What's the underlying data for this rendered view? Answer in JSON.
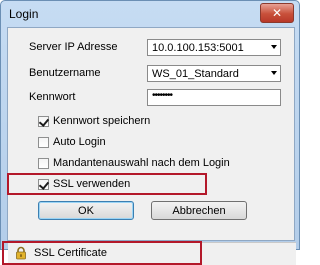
{
  "window": {
    "title": "Login",
    "close_glyph": "✕"
  },
  "form": {
    "server_label": "Server IP Adresse",
    "server_value": "10.0.100.153:5001",
    "user_label": "Benutzername",
    "user_value": "WS_01_Standard",
    "password_label": "Kennwort",
    "password_value": "••••••••"
  },
  "options": {
    "save_password": {
      "label": "Kennwort speichern",
      "checked": true
    },
    "auto_login": {
      "label": "Auto Login",
      "checked": false
    },
    "client_selection": {
      "label": "Mandantenauswahl nach dem Login",
      "checked": false
    },
    "use_ssl": {
      "label": "SSL verwenden",
      "checked": true
    }
  },
  "buttons": {
    "ok": "OK",
    "cancel": "Abbrechen"
  },
  "status": {
    "icon": "lock-icon",
    "text": "SSL Certificate"
  },
  "colors": {
    "highlight": "#b3182a",
    "accent": "#3c7fb1"
  }
}
